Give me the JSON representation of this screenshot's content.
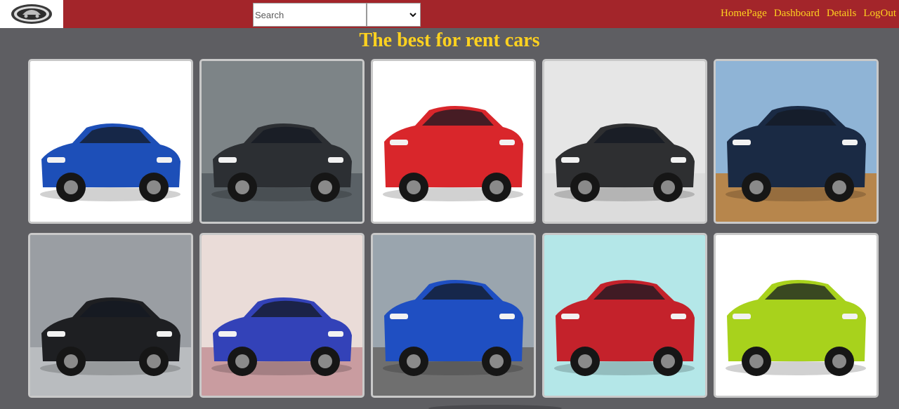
{
  "header": {
    "logo_icon": "car-emblem-logo-icon",
    "search": {
      "placeholder": "Search",
      "value": ""
    },
    "filter_select": {
      "selected": ""
    },
    "nav": [
      {
        "label": "HomePage"
      },
      {
        "label": "Dashboard"
      },
      {
        "label": "Details"
      },
      {
        "label": "LogOut"
      }
    ]
  },
  "main": {
    "title": "The best for rent cars"
  },
  "cars": [
    {
      "icon": "blue-sedan-image",
      "bg": "#ffffff",
      "ground": "#ffffff",
      "body": "#1d4fb8"
    },
    {
      "icon": "black-camo-coupe-image",
      "bg": "#7d8487",
      "ground": "#5a6166",
      "body": "#2c2f33"
    },
    {
      "icon": "red-suv-image",
      "bg": "#ffffff",
      "ground": "#ffffff",
      "body": "#d9262b"
    },
    {
      "icon": "black-coupe-image",
      "bg": "#e6e6e6",
      "ground": "#dcdcdc",
      "body": "#2e2f31"
    },
    {
      "icon": "dark-blue-suv-image",
      "bg": "#8fb4d6",
      "ground": "#b7864c",
      "body": "#1a2a44"
    },
    {
      "icon": "black-accord-sedan-image",
      "bg": "#9a9ea3",
      "ground": "#b9bcbf",
      "body": "#1e1f22"
    },
    {
      "icon": "blue-gran-coupe-image",
      "bg": "#eadcd8",
      "ground": "#c99ca0",
      "body": "#3342b8"
    },
    {
      "icon": "blue-suv-coupe-image",
      "bg": "#9aa5ae",
      "ground": "#6f6f6f",
      "body": "#1f4fc2"
    },
    {
      "icon": "red-hatchback-image",
      "bg": "#b4e7e8",
      "ground": "#b4e7e8",
      "body": "#c4222b"
    },
    {
      "icon": "lime-crossover-image",
      "bg": "#ffffff",
      "ground": "#ffffff",
      "body": "#a8d21c"
    }
  ]
}
